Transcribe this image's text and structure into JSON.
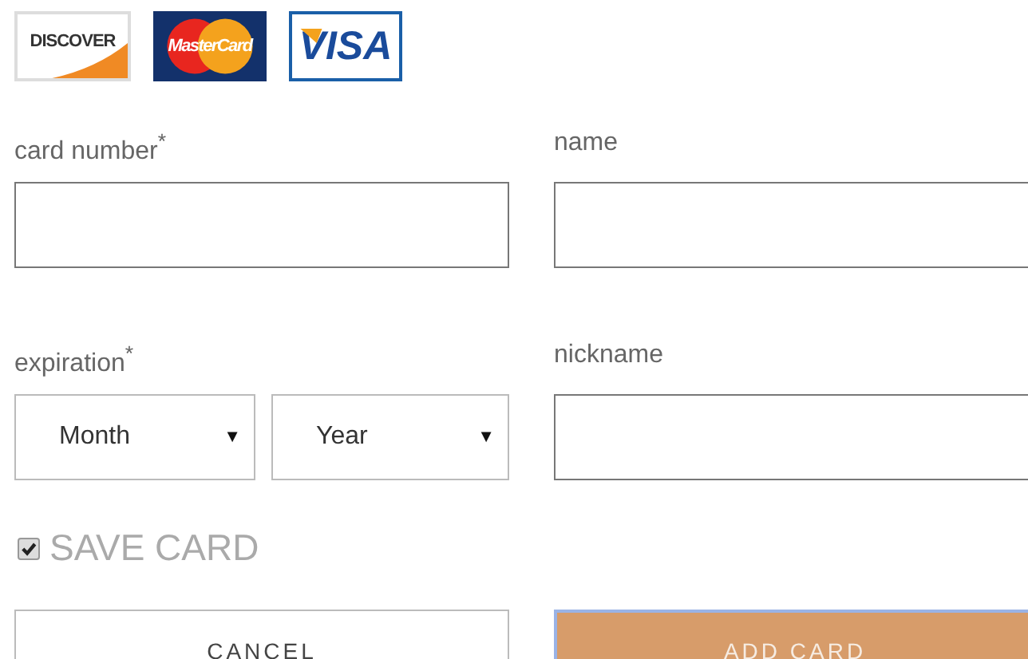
{
  "card_logos": [
    {
      "kind": "discover",
      "text": "DISCOVER"
    },
    {
      "kind": "mastercard",
      "text": "MasterCard"
    },
    {
      "kind": "visa",
      "text": "VISA"
    }
  ],
  "card_number": {
    "label": "card number$^{*}$"
  },
  "name": {
    "label": "name"
  },
  "expiration": {
    "label": "expiration$^{*}$",
    "month": {
      "value": "Month",
      "arrow": "▼"
    },
    "year": {
      "value": "Year",
      "arrow": "▼"
    }
  },
  "nickname": {
    "label": "nickname"
  },
  "save_card": {
    "label": "SAVE CARD",
    "checked": true
  },
  "buttons": [
    {
      "kind": "secondary",
      "label": "CANCEL"
    },
    {
      "kind": "primary",
      "label": "ADD CARD"
    }
  ]
}
